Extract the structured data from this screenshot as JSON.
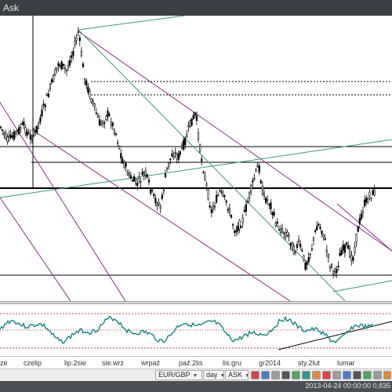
{
  "window": {
    "title": "Ask"
  },
  "xaxis_labels": [
    "ze",
    "czelip",
    "lip.2sie",
    "sie.wrz",
    "wrpaź",
    "paź.2lis",
    "lis.gru",
    "gr2014",
    "sty.2lut",
    "lumar"
  ],
  "toolbar": {
    "symbol": "EUR/GBP",
    "timeframe": "day",
    "price_type": "ASK",
    "icons": [
      "close-icon",
      "cursor-icon",
      "zoom-icon",
      "chart-type-icon",
      "indicator-icon",
      "line-tool-icon",
      "fibonacci-icon",
      "alert-icon",
      "settings-icon",
      "save-icon",
      "print-icon",
      "help-icon",
      "scroll-icon",
      "more-icon",
      "extra-icon"
    ]
  },
  "status": {
    "datetime": "2013-04-24 00:00:00",
    "value": "0,835"
  },
  "colors": {
    "title_bg": "#3a3f46",
    "candle_body": "#000000",
    "trendline_purple": "#8b2b8b",
    "trendline_green": "#3a9a7a",
    "oscillator": "#1f8a88",
    "osc_level": "#d23c3c"
  }
}
